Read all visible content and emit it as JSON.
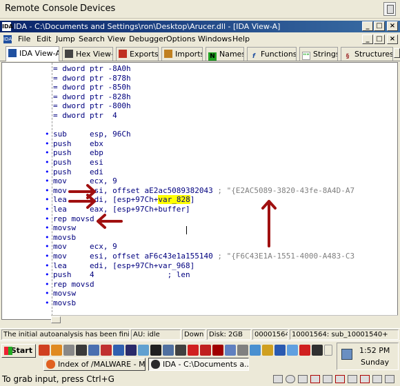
{
  "remote_console": {
    "menu": [
      "Remote Console",
      "Devices"
    ],
    "hint": "To grab input, press Ctrl+G"
  },
  "ida": {
    "title": "IDA - C:\\Documents and Settings\\ron\\Desktop\\Arucer.dll - [IDA View-A]",
    "menu": [
      "File",
      "Edit",
      "Jump",
      "Search",
      "View",
      "Debugger",
      "Options",
      "Windows",
      "Help"
    ],
    "tabs": [
      "IDA View-A",
      "Hex View-A",
      "Exports",
      "Imports",
      "Names",
      "Functions",
      "Strings",
      "Structures"
    ],
    "tab_icons": [
      "IDA",
      "HEX",
      "EXP",
      "IMP",
      "N",
      "f",
      "\"\"",
      "S"
    ]
  },
  "code_lines": [
    {
      "dot": "",
      "text": "= dword ptr -8A0h"
    },
    {
      "dot": "",
      "text": "= dword ptr -878h"
    },
    {
      "dot": "",
      "text": "= dword ptr -850h"
    },
    {
      "dot": "",
      "text": "= dword ptr -828h"
    },
    {
      "dot": "",
      "text": "= dword ptr -800h"
    },
    {
      "dot": "",
      "text": "= dword ptr  4"
    },
    {
      "dot": "",
      "text": ""
    },
    {
      "dot": "•",
      "text": "sub     esp, 96Ch"
    },
    {
      "dot": "•",
      "text": "push    ebx"
    },
    {
      "dot": "•",
      "text": "push    ebp"
    },
    {
      "dot": "•",
      "text": "push    esi"
    },
    {
      "dot": "•",
      "text": "push    edi"
    },
    {
      "dot": "•",
      "text": "mov     ecx, 9"
    },
    {
      "dot": "•",
      "text": "mov     esi, offset aE2ac5089382043 ",
      "comment": "; \"{E2AC5089-3820-43fe-8A4D-A7"
    },
    {
      "dot": "•",
      "text": "lea     edi, [esp+97Ch+",
      "hl": "var_828",
      "tail": "]"
    },
    {
      "dot": "•",
      "text": "lea     eax, [esp+97Ch+buffer]"
    },
    {
      "dot": "•",
      "text": "rep movsd"
    },
    {
      "dot": "•",
      "text": "movsw"
    },
    {
      "dot": "•",
      "text": "movsb"
    },
    {
      "dot": "•",
      "text": "mov     ecx, 9"
    },
    {
      "dot": "•",
      "text": "mov     esi, offset aF6c43e1a155140 ",
      "comment": "; \"{F6C43E1A-1551-4000-A483-C3"
    },
    {
      "dot": "•",
      "text": "lea     edi, [esp+97Ch+var_968]"
    },
    {
      "dot": "•",
      "text": "push    4                ; len"
    },
    {
      "dot": "•",
      "text": "rep movsd"
    },
    {
      "dot": "•",
      "text": "movsw"
    },
    {
      "dot": "•",
      "text": "movsb"
    }
  ],
  "status_bar": [
    "The initial autoanalysis has been finished.",
    "AU:  idle",
    "Down",
    "Disk: 2GB",
    "00001564",
    "10001564: sub_10001540+"
  ],
  "taskbar": {
    "start_label": "Start",
    "buttons": [
      "Index of /MALWARE - M...",
      "IDA - C:\\Documents a..."
    ],
    "time": "1:52 PM",
    "day": "Sunday"
  },
  "colors": {
    "code_text": "#00007f",
    "comment": "#7f7f7f",
    "highlight": "#ffff00",
    "arrow": "#a01010",
    "title_bar": "#0a246a"
  }
}
